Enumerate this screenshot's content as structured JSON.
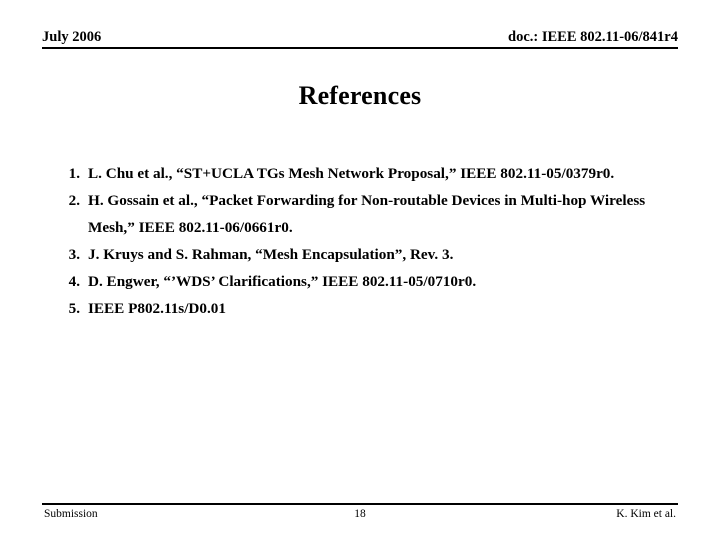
{
  "header": {
    "date": "July 2006",
    "doc_id": "doc.: IEEE 802.11-06/841r4"
  },
  "slide": {
    "title": "References"
  },
  "references": [
    {
      "number": "1.",
      "text": "L. Chu et al., “ST+UCLA TGs Mesh Network Proposal,” IEEE 802.11-05/0379r0."
    },
    {
      "number": "2.",
      "text": "H. Gossain et al., “Packet Forwarding for Non-routable Devices in Multi-hop Wireless Mesh,” IEEE 802.11-06/0661r0."
    },
    {
      "number": "3.",
      "text": "J. Kruys and S. Rahman, “Mesh Encapsulation”, Rev. 3."
    },
    {
      "number": "4.",
      "text": "D. Engwer, “’WDS’ Clarifications,” IEEE 802.11-05/0710r0."
    },
    {
      "number": "5.",
      "text": "IEEE P802.11s/D0.01"
    }
  ],
  "footer": {
    "left": "Submission",
    "page": "18",
    "right": "K. Kim et al."
  },
  "colors": {
    "background": "#ffffff",
    "text": "#000000",
    "rule": "#000000"
  }
}
